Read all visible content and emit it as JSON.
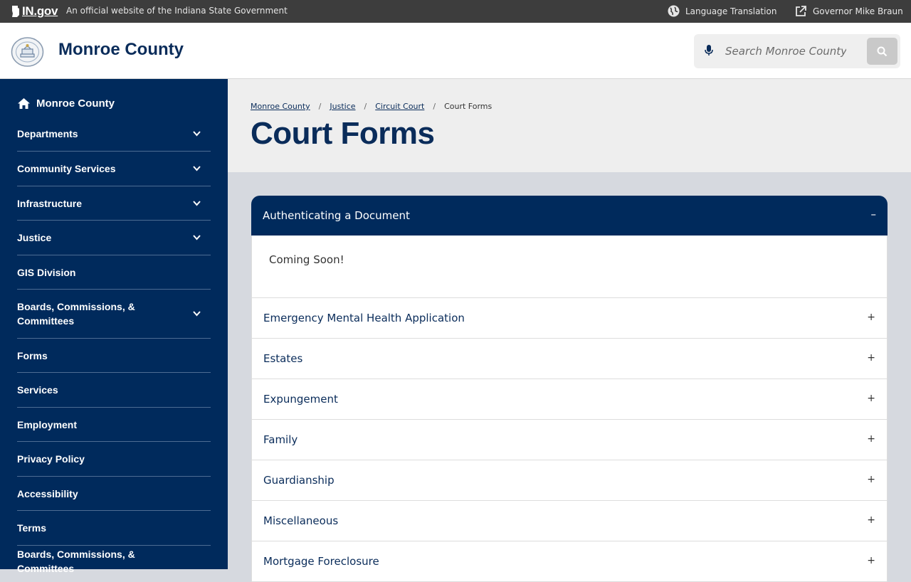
{
  "topbar": {
    "ingov_logo": "IN.gov",
    "official_text": "An official website of the Indiana State Government",
    "language_label": "Language Translation",
    "governor_label": "Governor Mike Braun"
  },
  "header": {
    "site_title": "Monroe County",
    "search_placeholder": "Search Monroe County"
  },
  "sidebar": {
    "home_label": "Monroe County",
    "items": [
      {
        "label": "Departments",
        "expandable": true
      },
      {
        "label": "Community Services",
        "expandable": true
      },
      {
        "label": "Infrastructure",
        "expandable": true
      },
      {
        "label": "Justice",
        "expandable": true
      },
      {
        "label": "GIS Division",
        "expandable": false
      },
      {
        "label": "Boards, Commissions, & Committees",
        "expandable": true
      },
      {
        "label": "Forms",
        "expandable": false
      },
      {
        "label": "Services",
        "expandable": false
      },
      {
        "label": "Employment",
        "expandable": false
      },
      {
        "label": "Privacy Policy",
        "expandable": false
      },
      {
        "label": "Accessibility",
        "expandable": false
      },
      {
        "label": "Terms",
        "expandable": false
      },
      {
        "label": "Boards, Commissions, & Committees",
        "expandable": false
      }
    ]
  },
  "breadcrumb": {
    "items": [
      "Monroe County",
      "Justice",
      "Circuit Court"
    ],
    "current": "Court Forms"
  },
  "page": {
    "title": "Court Forms"
  },
  "accordion": {
    "open_item": {
      "label": "Authenticating a Document",
      "toggle": "–",
      "body": "Coming Soon!"
    },
    "items": [
      {
        "label": "Emergency Mental Health Application",
        "toggle": "+"
      },
      {
        "label": "Estates",
        "toggle": "+"
      },
      {
        "label": "Expungement",
        "toggle": "+"
      },
      {
        "label": "Family",
        "toggle": "+"
      },
      {
        "label": "Guardianship",
        "toggle": "+"
      },
      {
        "label": "Miscellaneous",
        "toggle": "+"
      },
      {
        "label": "Mortgage Foreclosure",
        "toggle": "+"
      }
    ]
  }
}
